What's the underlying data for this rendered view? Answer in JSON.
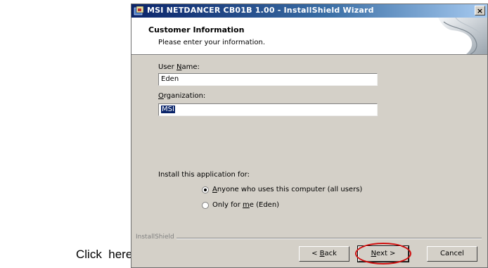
{
  "window": {
    "title": "MSI NETDANCER CB01B 1.00 - InstallShield Wizard",
    "close_symbol": "×"
  },
  "header": {
    "heading": "Customer Information",
    "subheading": "Please enter your information."
  },
  "form": {
    "user_name_label_prefix": "User ",
    "user_name_label_key": "N",
    "user_name_label_suffix": "ame:",
    "user_name_value": "Eden",
    "organization_label_key": "O",
    "organization_label_suffix": "rganization:",
    "organization_value": "MSI",
    "install_for_label": "Install this application for:",
    "options": [
      {
        "key": "A",
        "rest": "nyone who uses this computer (all users)",
        "checked": true
      },
      {
        "pre": "Only for ",
        "key": "m",
        "rest": "e (Eden)",
        "checked": false
      }
    ]
  },
  "footer": {
    "brand": "InstallShield",
    "back_prefix": "< ",
    "back_key": "B",
    "back_suffix": "ack",
    "next_key": "N",
    "next_suffix": "ext >",
    "cancel_label": "Cancel"
  },
  "annotation": {
    "text": "Click  here",
    "color": "#d01010"
  }
}
